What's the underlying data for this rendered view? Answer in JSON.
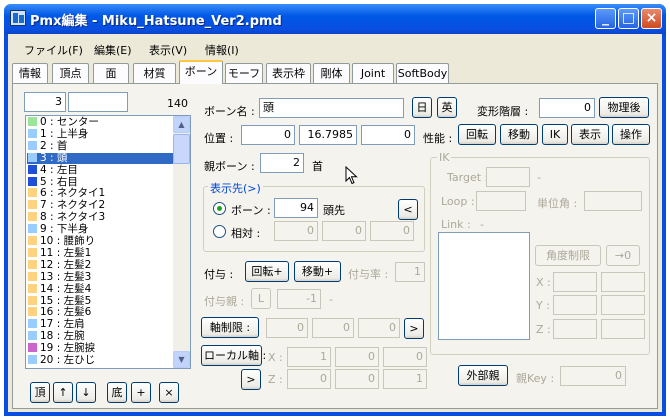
{
  "window": {
    "title": "Pmx編集 - Miku_Hatsune_Ver2.pmd",
    "minimize": "_",
    "maximize": "□",
    "close": "×"
  },
  "menu": [
    "ファイル(F)",
    "編集(E)",
    "表示(V)",
    "情報(I)"
  ],
  "tabs": [
    "情報",
    "頂点",
    "面",
    "材質",
    "ボーン",
    "モーフ",
    "表示枠",
    "剛体",
    "Joint",
    "SoftBody"
  ],
  "active_tab": "ボーン",
  "list": {
    "index_value": "3",
    "name_filter": "",
    "count": "140",
    "items": [
      {
        "label": "0 : センター",
        "color": "#99e699"
      },
      {
        "label": "1 : 上半身",
        "color": "#99ccff"
      },
      {
        "label": "2 : 首",
        "color": "#99ccff"
      },
      {
        "label": "3 : 頭",
        "color": "#99ccff"
      },
      {
        "label": "4 : 左目",
        "color": "#1f4fd6"
      },
      {
        "label": "5 : 右目",
        "color": "#1f4fd6"
      },
      {
        "label": "6 : ネクタイ1",
        "color": "#ffd27f"
      },
      {
        "label": "7 : ネクタイ2",
        "color": "#ffd27f"
      },
      {
        "label": "8 : ネクタイ3",
        "color": "#ffd27f"
      },
      {
        "label": "9 : 下半身",
        "color": "#99ccff"
      },
      {
        "label": "10 : 腰飾り",
        "color": "#ffd27f"
      },
      {
        "label": "11 : 左髪1",
        "color": "#ffd27f"
      },
      {
        "label": "12 : 左髪2",
        "color": "#ffd27f"
      },
      {
        "label": "13 : 左髪3",
        "color": "#ffd27f"
      },
      {
        "label": "14 : 左髪4",
        "color": "#ffd27f"
      },
      {
        "label": "15 : 左髪5",
        "color": "#ffd27f"
      },
      {
        "label": "16 : 左髪6",
        "color": "#ffd27f"
      },
      {
        "label": "17 : 左肩",
        "color": "#99ccff"
      },
      {
        "label": "18 : 左腕",
        "color": "#99ccff"
      },
      {
        "label": "19 : 左腕捩",
        "color": "#cc66cc"
      },
      {
        "label": "20 : 左ひじ",
        "color": "#99ccff"
      }
    ],
    "selected_index": 3,
    "buttons": [
      "頂",
      "↑",
      "↓",
      "底",
      "+",
      "×"
    ]
  },
  "bone": {
    "name_label": "ボーン名 :",
    "name_value": "頭",
    "jp_btn": "日",
    "en_btn": "英",
    "deform_label": "変形階層 :",
    "deform_value": "0",
    "physics_btn": "物理後",
    "position_label": "位置 :",
    "position": [
      "0",
      "16.7985",
      "0"
    ],
    "perf_label": "性能 :",
    "perf_buttons": [
      "回転",
      "移動",
      "IK",
      "表示",
      "操作"
    ],
    "parent_label": "親ボーン :",
    "parent_value": "2",
    "parent_name": "首",
    "dest_group": "表示先(>)",
    "radio_bone": "ボーン :",
    "dest_value": "94",
    "dest_name": "頭先",
    "dest_btn": "<",
    "radio_rel": "相対 :",
    "rel_values": [
      "0",
      "0",
      "0"
    ],
    "append_label": "付与 :",
    "append_rot": "回転+",
    "append_move": "移動+",
    "append_rate_label": "付与率 :",
    "append_rate": "1",
    "append_parent_label": "付与親 :",
    "append_parent_btn": "L",
    "append_parent_value": "-1",
    "append_parent_dash": "-",
    "axis_btn": "軸制限 :",
    "axis_values": [
      "0",
      "0",
      "0"
    ],
    "axis_arrow": ">",
    "local_btn": "ローカル軸 :",
    "local_x_label": "X :",
    "local_x": [
      "1",
      "0",
      "0"
    ],
    "local_arrow": ">",
    "local_z_label": "Z :",
    "local_z": [
      "0",
      "0",
      "1"
    ],
    "ext_parent_btn": "外部親",
    "ext_key_label": "親Key :",
    "ext_key_value": "0"
  },
  "ik": {
    "group": "IK",
    "target_label": "Target :",
    "target_dash": "-",
    "loop_label": "Loop :",
    "unit_label": "単位角 :",
    "link_label": "Link :",
    "link_dash": "-",
    "angle_btn": "角度制限",
    "arrow_btn": "→0",
    "x_label": "X :",
    "y_label": "Y :",
    "z_label": "Z :"
  }
}
